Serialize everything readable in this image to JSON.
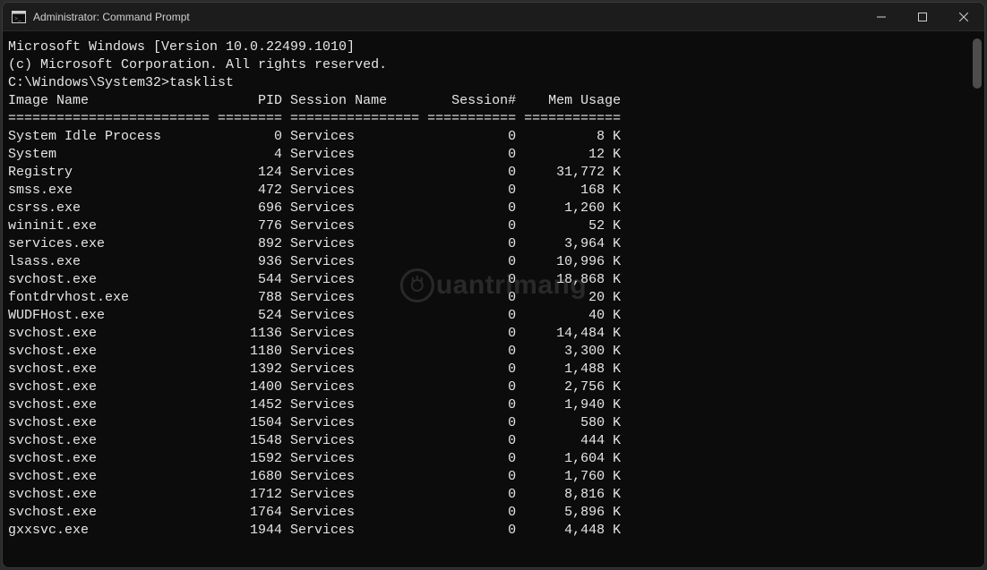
{
  "titlebar": {
    "title": "Administrator: Command Prompt"
  },
  "watermark": {
    "text": "uantrimang"
  },
  "terminal": {
    "banner_line1": "Microsoft Windows [Version 10.0.22499.1010]",
    "banner_line2": "(c) Microsoft Corporation. All rights reserved.",
    "prompt_path": "C:\\Windows\\System32>",
    "command": "tasklist",
    "headers": {
      "image_name": "Image Name",
      "pid": "PID",
      "session_name": "Session Name",
      "session_num": "Session#",
      "mem_usage": "Mem Usage"
    },
    "processes": [
      {
        "name": "System Idle Process",
        "pid": 0,
        "session": "Services",
        "snum": 0,
        "mem": "8 K"
      },
      {
        "name": "System",
        "pid": 4,
        "session": "Services",
        "snum": 0,
        "mem": "12 K"
      },
      {
        "name": "Registry",
        "pid": 124,
        "session": "Services",
        "snum": 0,
        "mem": "31,772 K"
      },
      {
        "name": "smss.exe",
        "pid": 472,
        "session": "Services",
        "snum": 0,
        "mem": "168 K"
      },
      {
        "name": "csrss.exe",
        "pid": 696,
        "session": "Services",
        "snum": 0,
        "mem": "1,260 K"
      },
      {
        "name": "wininit.exe",
        "pid": 776,
        "session": "Services",
        "snum": 0,
        "mem": "52 K"
      },
      {
        "name": "services.exe",
        "pid": 892,
        "session": "Services",
        "snum": 0,
        "mem": "3,964 K"
      },
      {
        "name": "lsass.exe",
        "pid": 936,
        "session": "Services",
        "snum": 0,
        "mem": "10,996 K"
      },
      {
        "name": "svchost.exe",
        "pid": 544,
        "session": "Services",
        "snum": 0,
        "mem": "18,868 K"
      },
      {
        "name": "fontdrvhost.exe",
        "pid": 788,
        "session": "Services",
        "snum": 0,
        "mem": "20 K"
      },
      {
        "name": "WUDFHost.exe",
        "pid": 524,
        "session": "Services",
        "snum": 0,
        "mem": "40 K"
      },
      {
        "name": "svchost.exe",
        "pid": 1136,
        "session": "Services",
        "snum": 0,
        "mem": "14,484 K"
      },
      {
        "name": "svchost.exe",
        "pid": 1180,
        "session": "Services",
        "snum": 0,
        "mem": "3,300 K"
      },
      {
        "name": "svchost.exe",
        "pid": 1392,
        "session": "Services",
        "snum": 0,
        "mem": "1,488 K"
      },
      {
        "name": "svchost.exe",
        "pid": 1400,
        "session": "Services",
        "snum": 0,
        "mem": "2,756 K"
      },
      {
        "name": "svchost.exe",
        "pid": 1452,
        "session": "Services",
        "snum": 0,
        "mem": "1,940 K"
      },
      {
        "name": "svchost.exe",
        "pid": 1504,
        "session": "Services",
        "snum": 0,
        "mem": "580 K"
      },
      {
        "name": "svchost.exe",
        "pid": 1548,
        "session": "Services",
        "snum": 0,
        "mem": "444 K"
      },
      {
        "name": "svchost.exe",
        "pid": 1592,
        "session": "Services",
        "snum": 0,
        "mem": "1,604 K"
      },
      {
        "name": "svchost.exe",
        "pid": 1680,
        "session": "Services",
        "snum": 0,
        "mem": "1,760 K"
      },
      {
        "name": "svchost.exe",
        "pid": 1712,
        "session": "Services",
        "snum": 0,
        "mem": "8,816 K"
      },
      {
        "name": "svchost.exe",
        "pid": 1764,
        "session": "Services",
        "snum": 0,
        "mem": "5,896 K"
      },
      {
        "name": "gxxsvc.exe",
        "pid": 1944,
        "session": "Services",
        "snum": 0,
        "mem": "4,448 K"
      }
    ],
    "col_widths": {
      "name": 25,
      "pid": 8,
      "session": 16,
      "snum": 11,
      "mem": 12
    }
  }
}
